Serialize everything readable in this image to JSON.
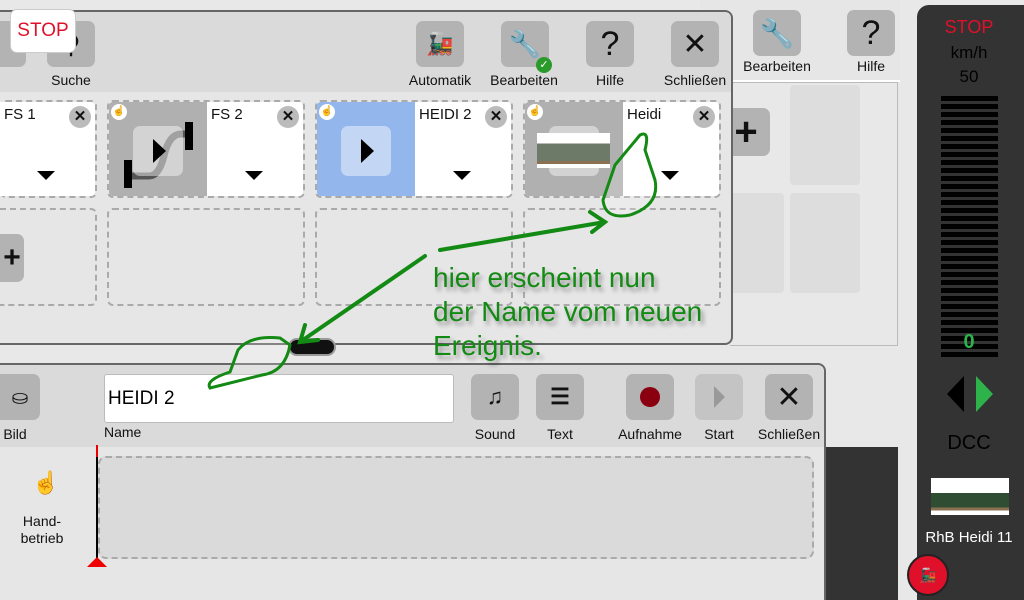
{
  "background_toolbar": {
    "edit_label": "Bearbeiten",
    "help_label": "Hilfe"
  },
  "stop_button": "STOP",
  "route_dialog": {
    "toolbar": {
      "search_label": "Suche",
      "automatic_label": "Automatik",
      "edit_label": "Bearbeiten",
      "help_label": "Hilfe",
      "close_label": "Schließen"
    },
    "tiles": [
      {
        "name": "FS 1"
      },
      {
        "name": "FS 2"
      },
      {
        "name": "HEIDI 2",
        "selected": true
      },
      {
        "name": "Heidi"
      }
    ]
  },
  "event_dialog": {
    "toolbar": {
      "image_label": "Bild",
      "name_value": "HEIDI 2",
      "name_label": "Name",
      "sound_label": "Sound",
      "text_label": "Text",
      "record_label": "Aufnahme",
      "start_label": "Start",
      "close_label": "Schließen"
    },
    "mode_label_1": "Hand-",
    "mode_label_2": "betrieb"
  },
  "control_panel": {
    "stop": "STOP",
    "unit": "km/h",
    "max_speed": "50",
    "speed": "0",
    "protocol": "DCC",
    "loco_name": "RhB Heidi 11"
  },
  "annotation": {
    "line1": "hier erscheint nun",
    "line2": "der Name vom neuen",
    "line3": "Ereignis."
  },
  "colors": {
    "stop_red": "#e0102a",
    "annotation_green": "#138a13",
    "selected_tile": "#93b6ec",
    "speed_green": "#2db34a",
    "record_red": "#8a0010"
  }
}
